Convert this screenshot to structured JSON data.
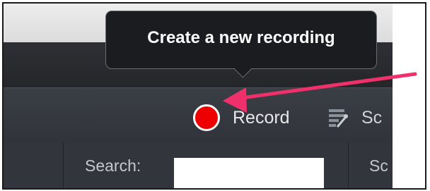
{
  "tooltip": {
    "text": "Create a new recording"
  },
  "toolbar": {
    "record_label": "Record",
    "record_color": "#ee0000",
    "next_label": "Sc",
    "next_icon": "script-icon"
  },
  "filter_bar": {
    "search_label": "Search:",
    "search_value": "",
    "right_column_label": "Sc"
  },
  "annotation": {
    "arrow_color": "#f0306a",
    "arrow_target": "record-button"
  }
}
